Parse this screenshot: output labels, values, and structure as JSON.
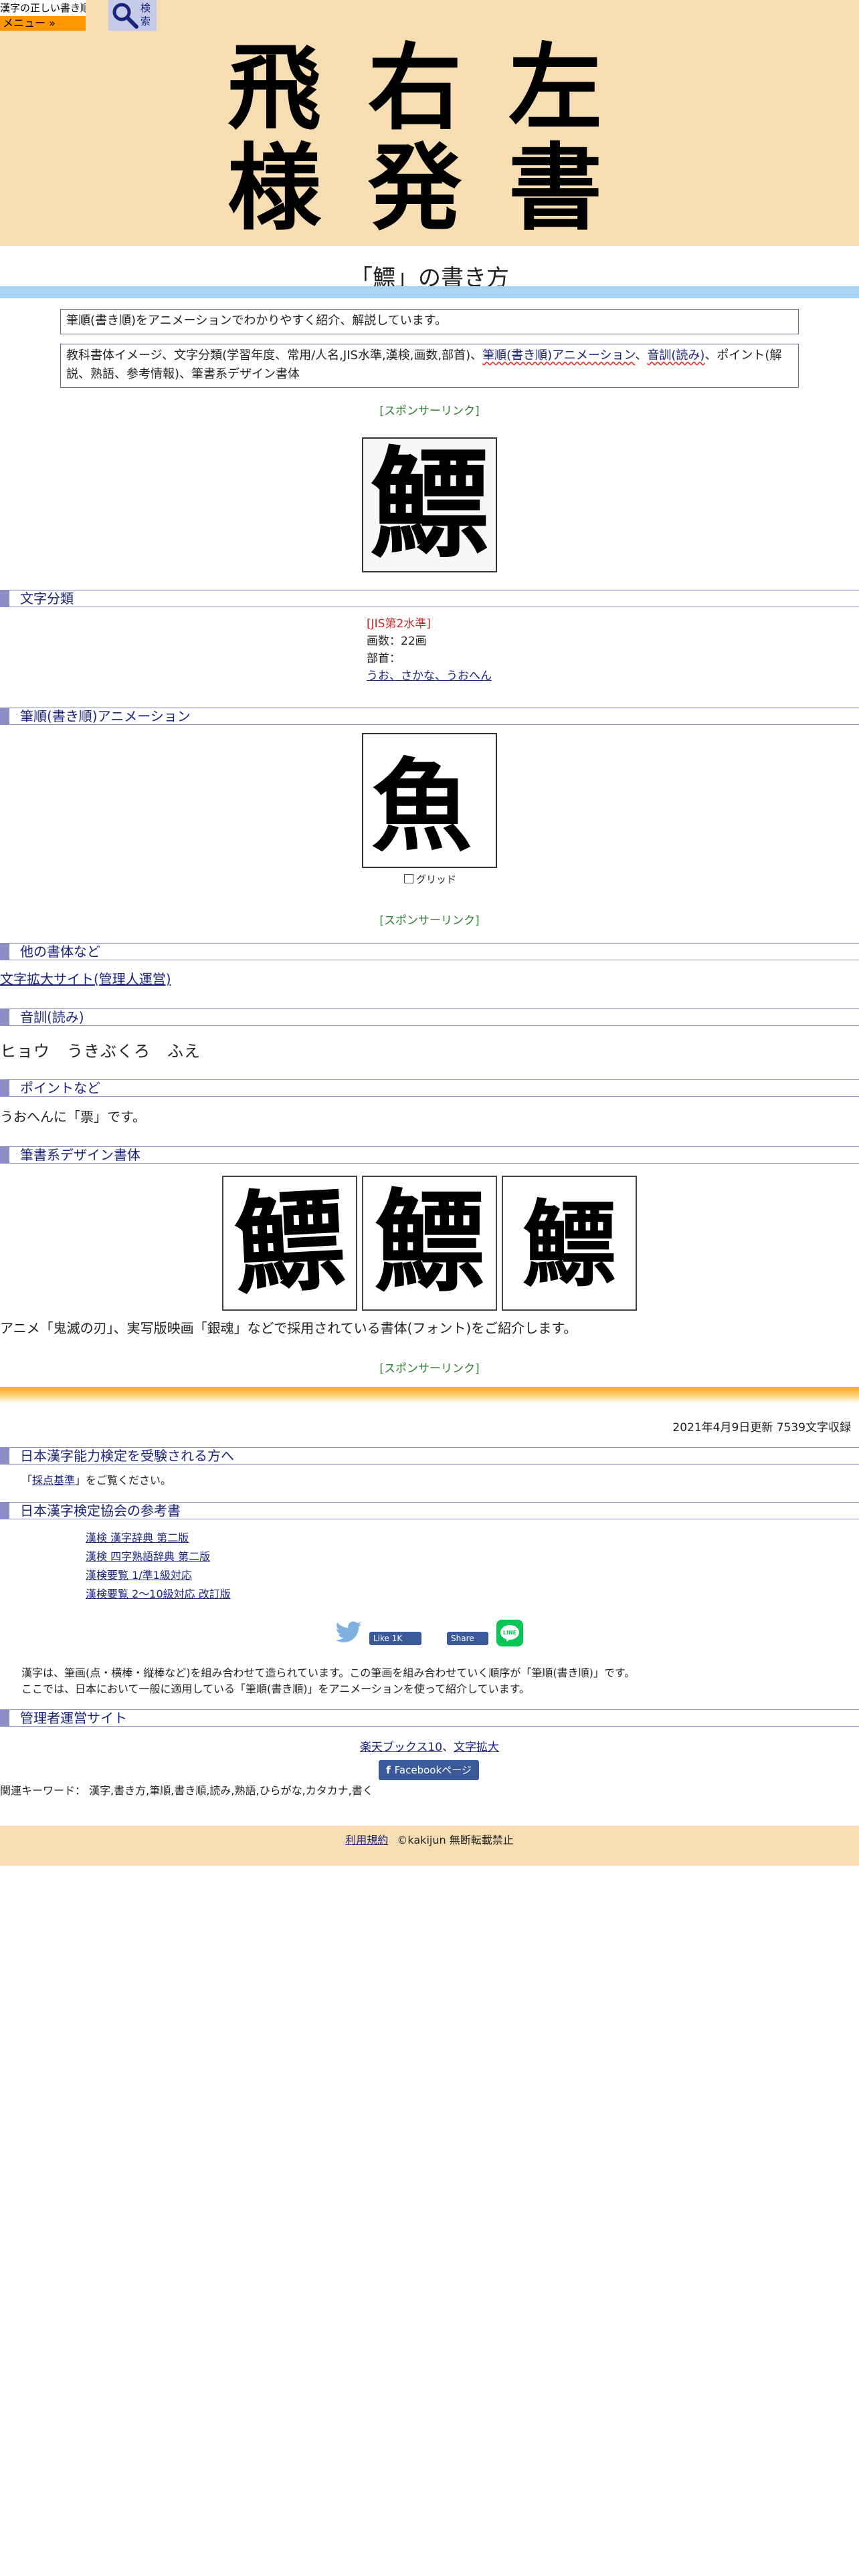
{
  "site": {
    "logo_text": "漢字の正しい書き順(筆順)",
    "menu_label": "メニュー »",
    "search_label": "検索"
  },
  "header": {
    "glyphs": [
      "飛",
      "右",
      "左",
      "様",
      "発",
      "書"
    ]
  },
  "title": "「鰾」の書き方",
  "descriptions": {
    "line1": "筆順(書き順)をアニメーションでわかりやすく紹介、解説しています。",
    "line2_prefix": "教科書体イメージ、文字分類(学習年度、常用/人名,JIS水準,漢検,画数,部首)、",
    "line2_link1": "筆順(書き順)アニメーション",
    "line2_sep": "、",
    "line2_link2": "音訓(読み)",
    "line2_suffix": "、ポイント(解説、熟語、参考情報)、筆書系デザイン書体"
  },
  "sponsor_label": "[スポンサーリンク]",
  "character": "鰾",
  "anim_character": "魚",
  "sections": {
    "classification": "文字分類",
    "animation": "筆順(書き順)アニメーション",
    "other_fonts": "他の書体など",
    "readings": "音訓(読み)",
    "point": "ポイントなど",
    "design": "筆書系デザイン書体",
    "kentei": "日本漢字能力検定を受験される方へ",
    "kentei_refs": "日本漢字検定協会の参考書",
    "admin": "管理者運営サイト"
  },
  "classification": {
    "jis": "[JIS第2水準]",
    "strokes": "画数：22画",
    "radical_label": "部首：",
    "radical_link": "うお、さかな、うおへん"
  },
  "grid_label": "グリッド",
  "other_fonts_link": "文字拡大サイト(管理人運営)",
  "readings": "ヒョウ　うきぶくろ　ふえ",
  "point_text": "うおへんに「票」です。",
  "design_text": "アニメ「鬼滅の刃」、実写版映画「銀魂」などで採用されている書体(フォント)をご紹介します。",
  "updated": "2021年4月9日更新 7539文字収録",
  "kentei_note": {
    "prefix": "「",
    "link": "採点基準",
    "suffix": "」をご覧ください。"
  },
  "ref_books": [
    "漢検 漢字辞典 第二版",
    "漢検 四字熟語辞典 第二版",
    "漢検要覧 1/準1級対応",
    "漢検要覧 2〜10級対応 改訂版"
  ],
  "share": {
    "like_label": "Like 1K",
    "share_label": "Share",
    "line_label": "LINE"
  },
  "kanji_explain": [
    "漢字は、筆画(点・横棒・縦棒など)を組み合わせて造られています。この筆画を組み合わせていく順序が「筆順(書き順)」です。",
    "ここでは、日本において一般に適用している「筆順(書き順)」をアニメーションを使って紹介しています。"
  ],
  "admin_links": {
    "link1": "楽天ブックス10",
    "sep": "、",
    "link2": "文字拡大"
  },
  "facebook_page": "Facebookページ",
  "keywords": "関連キーワード： 漢字,書き方,筆順,書き順,読み,熟語,ひらがな,カタカナ,書く",
  "footer": {
    "terms": "利用規約",
    "copyright": "©kakijun 無断転載禁止"
  },
  "colors": {
    "header_bg": "#f6deb2",
    "title_bar": "#a9d4f5",
    "section_marker": "#8b8fc5",
    "menu_orange": "#ff9800",
    "sponsor_green": "#2e7d32"
  }
}
